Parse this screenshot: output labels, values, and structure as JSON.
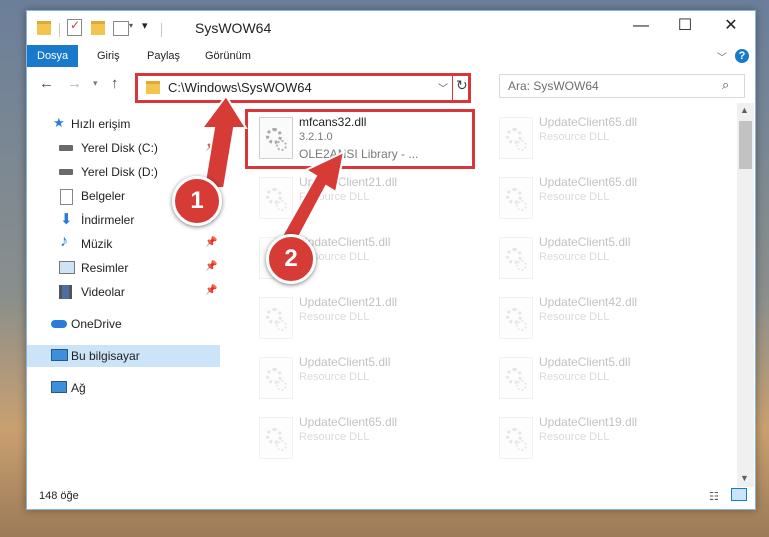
{
  "window": {
    "title": "SysWOW64",
    "controls": {
      "minimize": "—",
      "maximize": "☐",
      "close": "✕"
    }
  },
  "ribbon": {
    "tabs": [
      "Dosya",
      "Giriş",
      "Paylaş",
      "Görünüm"
    ],
    "help": "?"
  },
  "address": {
    "path": "C:\\Windows\\SysWOW64",
    "search_placeholder": "Ara: SysWOW64"
  },
  "nav": {
    "quick_access": "Hızlı erişim",
    "items": [
      {
        "label": "Yerel Disk (C:)",
        "pinned": true
      },
      {
        "label": "Yerel Disk (D:)",
        "pinned": true
      },
      {
        "label": "Belgeler",
        "pinned": true
      },
      {
        "label": "İndirmeler",
        "pinned": true
      },
      {
        "label": "Müzik",
        "pinned": true
      },
      {
        "label": "Resimler",
        "pinned": true
      },
      {
        "label": "Videolar",
        "pinned": true
      }
    ],
    "onedrive": "OneDrive",
    "this_pc": "Bu bilgisayar",
    "network": "Ağ"
  },
  "files": {
    "highlighted": {
      "name": "mfcans32.dll",
      "version": "3.2.1.0",
      "description": "OLE2ANSI Library - ..."
    },
    "left_column": [
      {
        "name": "UpdateClient21.dll",
        "type": "Resource DLL"
      },
      {
        "name": "UpdateClient5.dll",
        "type": "Resource DLL"
      },
      {
        "name": "UpdateClient21.dll",
        "type": "Resource DLL"
      },
      {
        "name": "UpdateClient5.dll",
        "type": "Resource DLL"
      },
      {
        "name": "UpdateClient65.dll",
        "type": "Resource DLL"
      }
    ],
    "right_column": [
      {
        "name": "UpdateClient65.dll",
        "type": "Resource DLL"
      },
      {
        "name": "UpdateClient65.dll",
        "type": "Resource DLL"
      },
      {
        "name": "UpdateClient5.dll",
        "type": "Resource DLL"
      },
      {
        "name": "UpdateClient42.dll",
        "type": "Resource DLL"
      },
      {
        "name": "UpdateClient5.dll",
        "type": "Resource DLL"
      },
      {
        "name": "UpdateClient19.dll",
        "type": "Resource DLL"
      }
    ]
  },
  "status": {
    "count": "148 öğe"
  },
  "callouts": {
    "one": "1",
    "two": "2"
  },
  "colors": {
    "accent": "#1979ca",
    "highlight": "#d9363b"
  }
}
